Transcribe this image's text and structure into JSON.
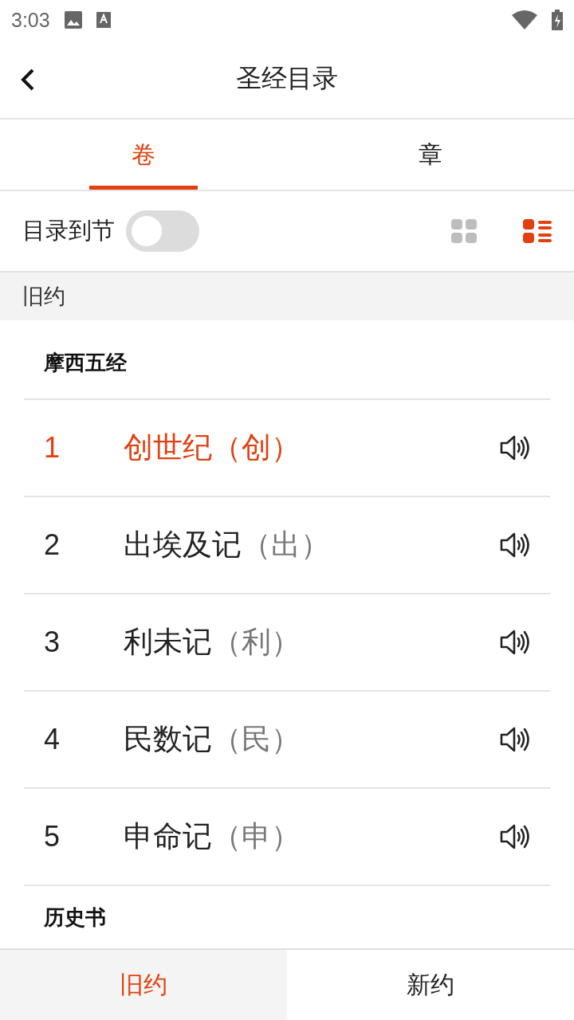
{
  "status_bar": {
    "time": "3:03"
  },
  "header": {
    "title": "圣经目录"
  },
  "tabs": [
    {
      "label": "卷",
      "selected": true
    },
    {
      "label": "章",
      "selected": false
    }
  ],
  "options": {
    "label": "目录到节",
    "on": false,
    "views": [
      {
        "kind": "grid",
        "selected": false
      },
      {
        "kind": "list",
        "selected": true
      }
    ]
  },
  "section": {
    "title": "旧约"
  },
  "groups": [
    {
      "title": "摩西五经",
      "books": [
        {
          "number": "1",
          "name": "创世纪",
          "abbr": "（创）",
          "selected": true
        },
        {
          "number": "2",
          "name": "出埃及记",
          "abbr": "（出）",
          "selected": false
        },
        {
          "number": "3",
          "name": "利未记",
          "abbr": "（利）",
          "selected": false
        },
        {
          "number": "4",
          "name": "民数记",
          "abbr": "（民）",
          "selected": false
        },
        {
          "number": "5",
          "name": "申命记",
          "abbr": "（申）",
          "selected": false
        }
      ]
    },
    {
      "title": "历史书"
    }
  ],
  "bottom_tabs": [
    {
      "label": "旧约",
      "selected": true
    },
    {
      "label": "新约",
      "selected": false
    }
  ]
}
